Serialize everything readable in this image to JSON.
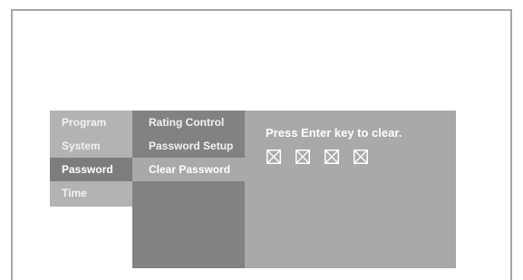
{
  "menu": {
    "categories": [
      {
        "label": "Program",
        "selected": false
      },
      {
        "label": "System",
        "selected": false
      },
      {
        "label": "Password",
        "selected": true
      },
      {
        "label": "Time",
        "selected": false
      }
    ],
    "submenu": [
      {
        "label": "Rating Control",
        "selected": false
      },
      {
        "label": "Password Setup",
        "selected": false
      },
      {
        "label": "Clear Password",
        "selected": true
      }
    ]
  },
  "content": {
    "prompt": "Press Enter key to clear.",
    "password_box_icon": "crossed-box-icon",
    "password_box_count": 4
  },
  "colors": {
    "category_bg": "#b3b3b3",
    "category_selected_bg": "#7d7d7d",
    "submenu_bg": "#828282",
    "submenu_selected_bg": "#a9a9a9",
    "panel_bg": "#a9a9a9"
  }
}
